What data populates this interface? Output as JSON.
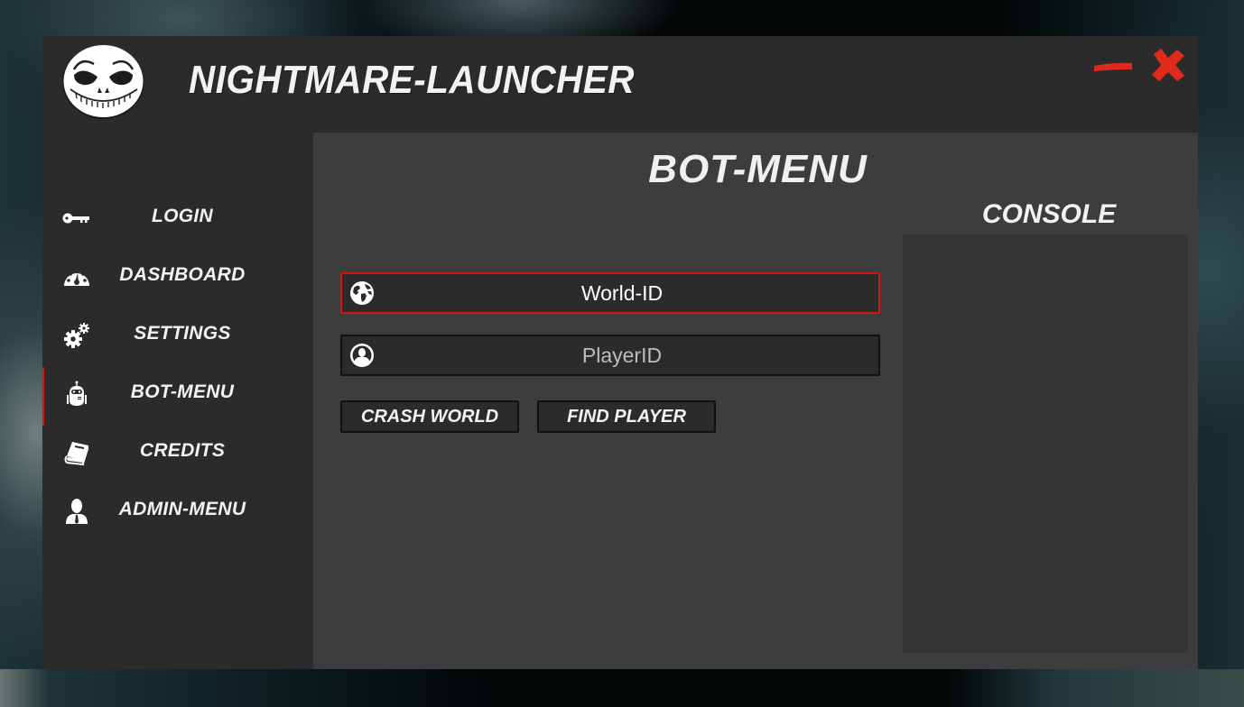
{
  "app": {
    "title": "NIGHTMARE-LAUNCHER",
    "logo_icon": "skull-face-icon",
    "minimize_icon": "minimize-icon",
    "close_icon": "close-icon",
    "accent_color": "#e02a1c"
  },
  "sidebar": {
    "active_index": 3,
    "items": [
      {
        "label": "LOGIN",
        "icon": "key-icon"
      },
      {
        "label": "DASHBOARD",
        "icon": "speedometer-icon"
      },
      {
        "label": "SETTINGS",
        "icon": "gears-icon"
      },
      {
        "label": "BOT-MENU",
        "icon": "robot-icon"
      },
      {
        "label": "CREDITS",
        "icon": "book-icon"
      },
      {
        "label": "ADMIN-MENU",
        "icon": "admin-user-icon"
      }
    ]
  },
  "main": {
    "title": "BOT-MENU",
    "world_field": {
      "placeholder": "World-ID",
      "value": "",
      "icon": "globe-icon"
    },
    "player_field": {
      "placeholder": "PlayerID",
      "value": "",
      "icon": "user-circle-icon"
    },
    "buttons": {
      "crash_world": "CRASH WORLD",
      "find_player": "FIND PLAYER"
    },
    "console": {
      "title": "CONSOLE",
      "content": ""
    }
  }
}
